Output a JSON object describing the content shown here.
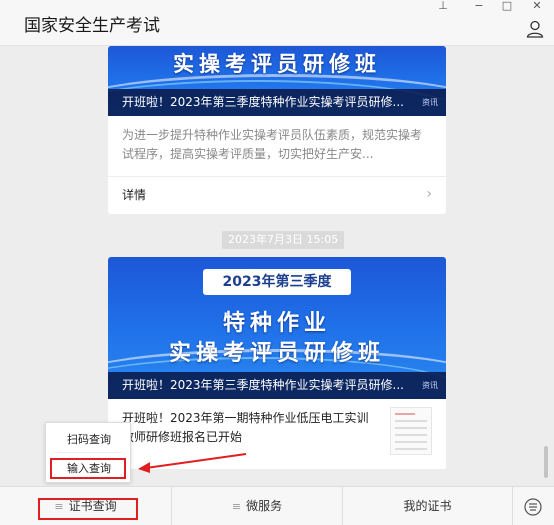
{
  "window": {
    "title": "国家安全生产考试",
    "pin_glyph": "⊥",
    "minimize_glyph": "−",
    "maximize_glyph": "□",
    "close_glyph": "✕",
    "user_icon": "user-icon"
  },
  "feed": {
    "card1": {
      "banner_line": "实操考评员研修班",
      "caption": "开班啦！2023年第三季度特种作业实操考评员研修...",
      "caption_tag": "资讯",
      "description": "为进一步提升特种作业实操考评员队伍素质，规范实操考试程序，提高实操考评质量，切实把好生产安...",
      "detail_label": "详情"
    },
    "timestamp": "2023年7月3日 15:05",
    "card2": {
      "season_label": "2023年第三季度",
      "banner_line1": "特种作业",
      "banner_line2": "实操考评员研修班",
      "caption": "开班啦！2023年第三季度特种作业实操考评员研修...",
      "caption_tag": "资讯"
    },
    "row_item": {
      "text": "开班啦！2023年第一期特种作业低压电工实训教师研修班报名已开始"
    }
  },
  "popup_menu": {
    "items": [
      "扫码查询",
      "输入查询"
    ]
  },
  "bottom_menu": {
    "items": [
      "证书查询",
      "微服务",
      "我的证书"
    ],
    "menu_glyph": "≡",
    "keyboard_icon": "keyboard-switch-icon"
  },
  "colors": {
    "accent_red": "#e02020",
    "banner_blue": "#1f6ee8"
  }
}
